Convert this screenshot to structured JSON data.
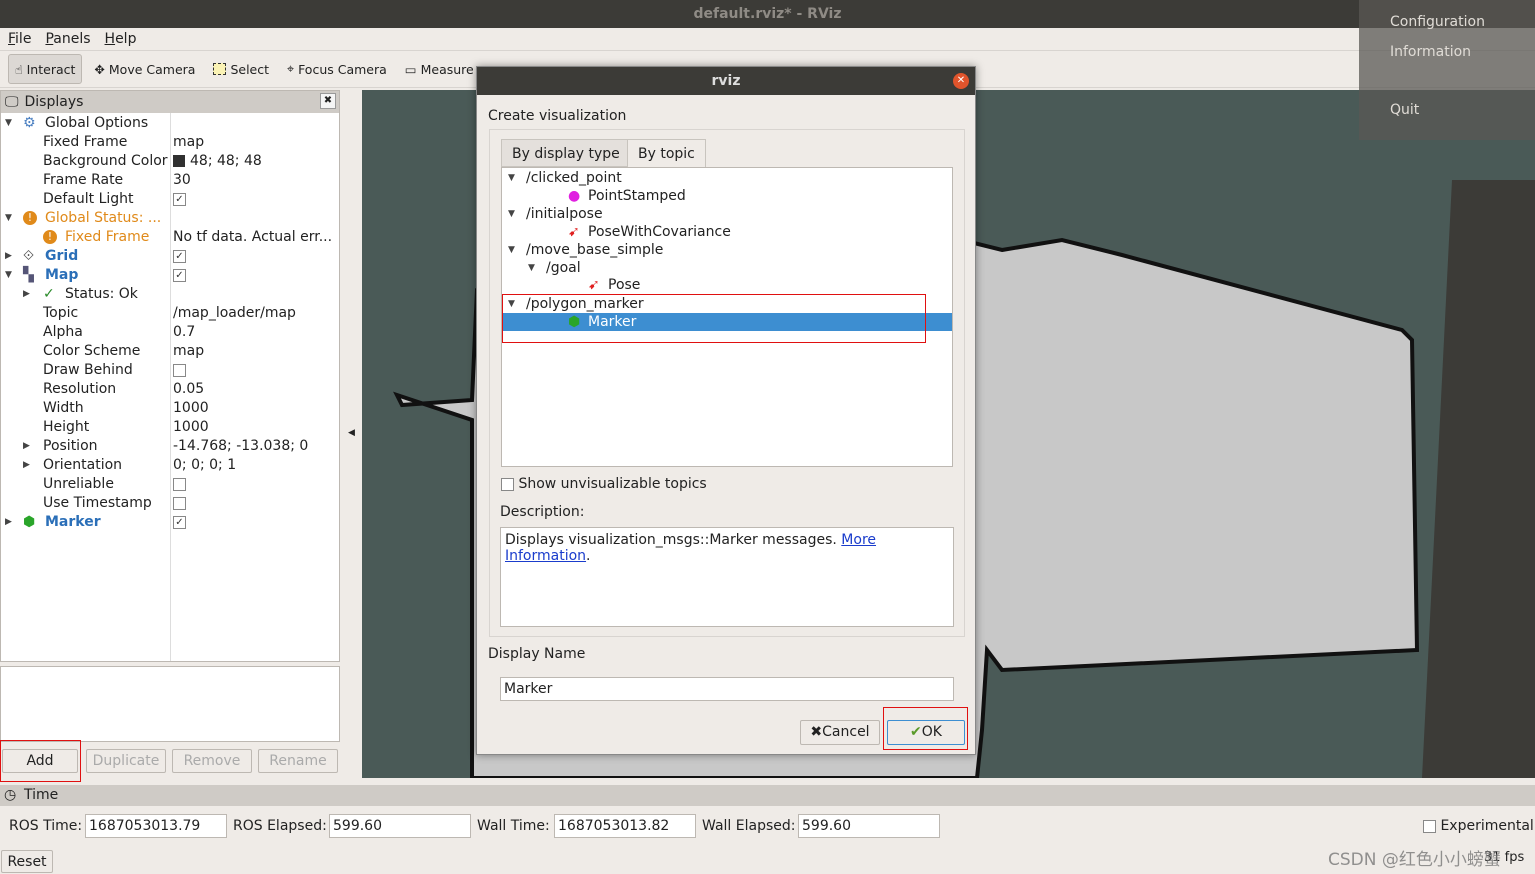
{
  "window": {
    "title": "default.rviz* - RViz"
  },
  "menu": [
    "File",
    "Panels",
    "Help"
  ],
  "toolbar": [
    {
      "label": "Interact",
      "icon": "hand-icon",
      "active": true
    },
    {
      "label": "Move Camera",
      "icon": "move-camera-icon"
    },
    {
      "label": "Select",
      "icon": "select-icon"
    },
    {
      "label": "Focus Camera",
      "icon": "focus-camera-icon"
    },
    {
      "label": "Measure",
      "icon": "ruler-icon"
    }
  ],
  "context_menu": [
    "Configuration",
    "Information",
    "Quit"
  ],
  "displays": {
    "title": "Displays",
    "rows": [
      {
        "k": "Global Options",
        "v": "",
        "level": 0,
        "exp": "open",
        "icon": "gear-icon"
      },
      {
        "k": "Fixed Frame",
        "v": "map",
        "level": 1
      },
      {
        "k": "Background Color",
        "v": "48; 48; 48",
        "level": 1,
        "swatch": "#303030"
      },
      {
        "k": "Frame Rate",
        "v": "30",
        "level": 1
      },
      {
        "k": "Default Light",
        "v": "✓",
        "level": 1,
        "check": true
      },
      {
        "k": "Global Status: ...",
        "v": "",
        "level": 0,
        "exp": "open",
        "icon": "warning-icon",
        "cls": "orange"
      },
      {
        "k": "Fixed Frame",
        "v": "No tf data.  Actual err...",
        "level": 1,
        "icon": "warning-icon",
        "cls": "orange"
      },
      {
        "k": "Grid",
        "v": "✓",
        "level": 0,
        "exp": "closed",
        "icon": "grid-icon",
        "cls": "blue",
        "check": true
      },
      {
        "k": "Map",
        "v": "✓",
        "level": 0,
        "exp": "open",
        "icon": "map-icon",
        "cls": "blue",
        "check": true
      },
      {
        "k": "Status: Ok",
        "v": "",
        "level": 1,
        "exp": "closed",
        "icon": "check-icon"
      },
      {
        "k": "Topic",
        "v": "/map_loader/map",
        "level": 1
      },
      {
        "k": "Alpha",
        "v": "0.7",
        "level": 1
      },
      {
        "k": "Color Scheme",
        "v": "map",
        "level": 1
      },
      {
        "k": "Draw Behind",
        "v": "",
        "level": 1,
        "check": true
      },
      {
        "k": "Resolution",
        "v": "0.05",
        "level": 1
      },
      {
        "k": "Width",
        "v": "1000",
        "level": 1
      },
      {
        "k": "Height",
        "v": "1000",
        "level": 1
      },
      {
        "k": "Position",
        "v": "-14.768; -13.038; 0",
        "level": 1,
        "exp": "closed"
      },
      {
        "k": "Orientation",
        "v": "0; 0; 0; 1",
        "level": 1,
        "exp": "closed"
      },
      {
        "k": "Unreliable",
        "v": "",
        "level": 1,
        "check": true
      },
      {
        "k": "Use Timestamp",
        "v": "",
        "level": 1,
        "check": true
      },
      {
        "k": "Marker",
        "v": "✓",
        "level": 0,
        "exp": "closed",
        "icon": "marker-cube-icon",
        "cls": "blue",
        "check": true
      }
    ]
  },
  "buttons": {
    "add": "Add",
    "duplicate": "Duplicate",
    "remove": "Remove",
    "rename": "Rename"
  },
  "time": {
    "title": "Time",
    "ros_time_label": "ROS Time:",
    "ros_time": "1687053013.79",
    "ros_elapsed_label": "ROS Elapsed:",
    "ros_elapsed": "599.60",
    "wall_time_label": "Wall Time:",
    "wall_time": "1687053013.82",
    "wall_elapsed_label": "Wall Elapsed:",
    "wall_elapsed": "599.60",
    "experimental": "Experimental",
    "reset": "Reset",
    "fps": "31 fps"
  },
  "watermark": "CSDN @红色小小螃蟹",
  "dialog": {
    "title": "rviz",
    "heading": "Create visualization",
    "tabs": [
      "By display type",
      "By topic"
    ],
    "active_tab": 1,
    "tree": [
      {
        "t": "/clicked_point",
        "lvl": 0,
        "exp": true
      },
      {
        "t": "PointStamped",
        "lvl": 1,
        "icon": "point-icon"
      },
      {
        "t": "/initialpose",
        "lvl": 0,
        "exp": true
      },
      {
        "t": "PoseWithCovariance",
        "lvl": 1,
        "icon": "pose-arrow-icon"
      },
      {
        "t": "/move_base_simple",
        "lvl": 0,
        "exp": true
      },
      {
        "t": "/goal",
        "lvl": 1,
        "exp": true
      },
      {
        "t": "Pose",
        "lvl": 2,
        "icon": "pose-arrow-icon"
      },
      {
        "t": "/polygon_marker",
        "lvl": 0,
        "exp": true
      },
      {
        "t": "Marker",
        "lvl": 1,
        "icon": "marker-cube-icon",
        "selected": true
      }
    ],
    "show_unvisualizable": "Show unvisualizable topics",
    "description_label": "Description:",
    "description": "Displays visualization_msgs::Marker messages. ",
    "more_info": "More Information",
    "display_name_label": "Display Name",
    "display_name": "Marker",
    "cancel": "Cancel",
    "ok": "OK"
  },
  "colors": {
    "accent": "#3d8ed1",
    "highlight": "#e01010",
    "map_bg": "#4a5a57",
    "map_free": "#c8c8c8"
  }
}
